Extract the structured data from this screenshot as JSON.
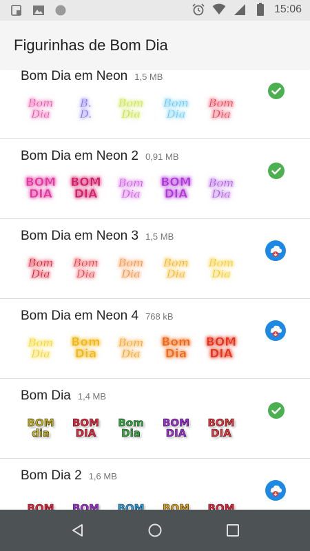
{
  "status_bar": {
    "time": "15:06",
    "left_icons": [
      "screenshot-icon",
      "image-icon",
      "circle-icon"
    ],
    "right_icons": [
      "alarm-icon",
      "wifi-icon",
      "signal-icon",
      "battery-icon"
    ]
  },
  "app_bar": {
    "title": "Figurinhas de Bom Dia"
  },
  "packs": [
    {
      "name": "Bom Dia em Neon",
      "size": "1,5 MB",
      "status": "added",
      "stickers": [
        {
          "text": "Bom\nDia",
          "color": "#e84aa4",
          "style": "neon-script"
        },
        {
          "text": "B.\nD.",
          "color": "#7b6cf0",
          "style": "neon-script"
        },
        {
          "text": "Bom\nDia",
          "color": "#c6e03a",
          "style": "neon-script"
        },
        {
          "text": "Bom\nDia",
          "color": "#5cc6f0",
          "style": "neon-script"
        },
        {
          "text": "Bom\nDia",
          "color": "#e8334a",
          "style": "neon-script"
        }
      ]
    },
    {
      "name": "Bom Dia em Neon 2",
      "size": "0,91 MB",
      "status": "added",
      "stickers": [
        {
          "text": "BOM\nDIA",
          "color": "#e23aa0",
          "style": "neon-block"
        },
        {
          "text": "BOM\nDIA",
          "color": "#d11f6a",
          "style": "neon-block"
        },
        {
          "text": "Bom\nDia",
          "color": "#c94be0",
          "style": "neon-script"
        },
        {
          "text": "BOM\nDIA",
          "color": "#b03ad8",
          "style": "neon-block"
        },
        {
          "text": "Bom\nDia",
          "color": "#a64fe0",
          "style": "neon-script"
        }
      ]
    },
    {
      "name": "Bom Dia em Neon 3",
      "size": "1,5 MB",
      "status": "download",
      "stickers": [
        {
          "text": "Bom\nDia",
          "color": "#d8102a",
          "style": "neon-script"
        },
        {
          "text": "Bom\nDia",
          "color": "#e8333a",
          "style": "neon-script"
        },
        {
          "text": "Bom\nDia",
          "color": "#f08a3a",
          "style": "neon-script"
        },
        {
          "text": "Bom\nDia",
          "color": "#f0b21a",
          "style": "neon-script"
        },
        {
          "text": "Bom\nDia",
          "color": "#f2c61a",
          "style": "neon-script"
        }
      ]
    },
    {
      "name": "Bom Dia em Neon 4",
      "size": "768 kB",
      "status": "download",
      "stickers": [
        {
          "text": "Bom\nDia",
          "color": "#f2d21a",
          "style": "neon-script"
        },
        {
          "text": "Bom\nDia",
          "color": "#f2b81a",
          "style": "neon-block"
        },
        {
          "text": "Bom\nDia",
          "color": "#f29a1a",
          "style": "neon-script"
        },
        {
          "text": "Bom\nDia",
          "color": "#f06a1a",
          "style": "neon-block"
        },
        {
          "text": "BOM\nDIA",
          "color": "#e8331a",
          "style": "neon-block"
        }
      ]
    },
    {
      "name": "Bom Dia",
      "size": "1,4 MB",
      "status": "added",
      "stickers": [
        {
          "text": "BOM\ndia",
          "color": "#c8b21a",
          "style": "chunky"
        },
        {
          "text": "BOM\nDIA",
          "color": "#e8233a",
          "style": "chunky"
        },
        {
          "text": "Bom\nDia",
          "color": "#2eab3a",
          "style": "chunky"
        },
        {
          "text": "BOM\nDIA",
          "color": "#a02ad8",
          "style": "chunky"
        },
        {
          "text": "BOM\nDIA",
          "color": "#e8333a",
          "style": "chunky"
        }
      ]
    },
    {
      "name": "Bom Dia 2",
      "size": "1,6 MB",
      "status": "download",
      "stickers": [
        {
          "text": "BOM",
          "color": "#e8233a",
          "style": "chunky"
        },
        {
          "text": "BOM",
          "color": "#a02ad8",
          "style": "chunky"
        },
        {
          "text": "BOM",
          "color": "#2aa0e0",
          "style": "chunky"
        },
        {
          "text": "BOM",
          "color": "#e0a21a",
          "style": "chunky"
        },
        {
          "text": "BOM",
          "color": "#e8233a",
          "style": "chunky"
        }
      ]
    }
  ],
  "colors": {
    "added_green": "#4caf50",
    "download_blue": "#1e88e5",
    "download_red": "#e53935",
    "nav_bar": "#4d5254"
  },
  "nav_bar": {
    "buttons": [
      "back-icon",
      "home-icon",
      "recents-icon"
    ]
  }
}
